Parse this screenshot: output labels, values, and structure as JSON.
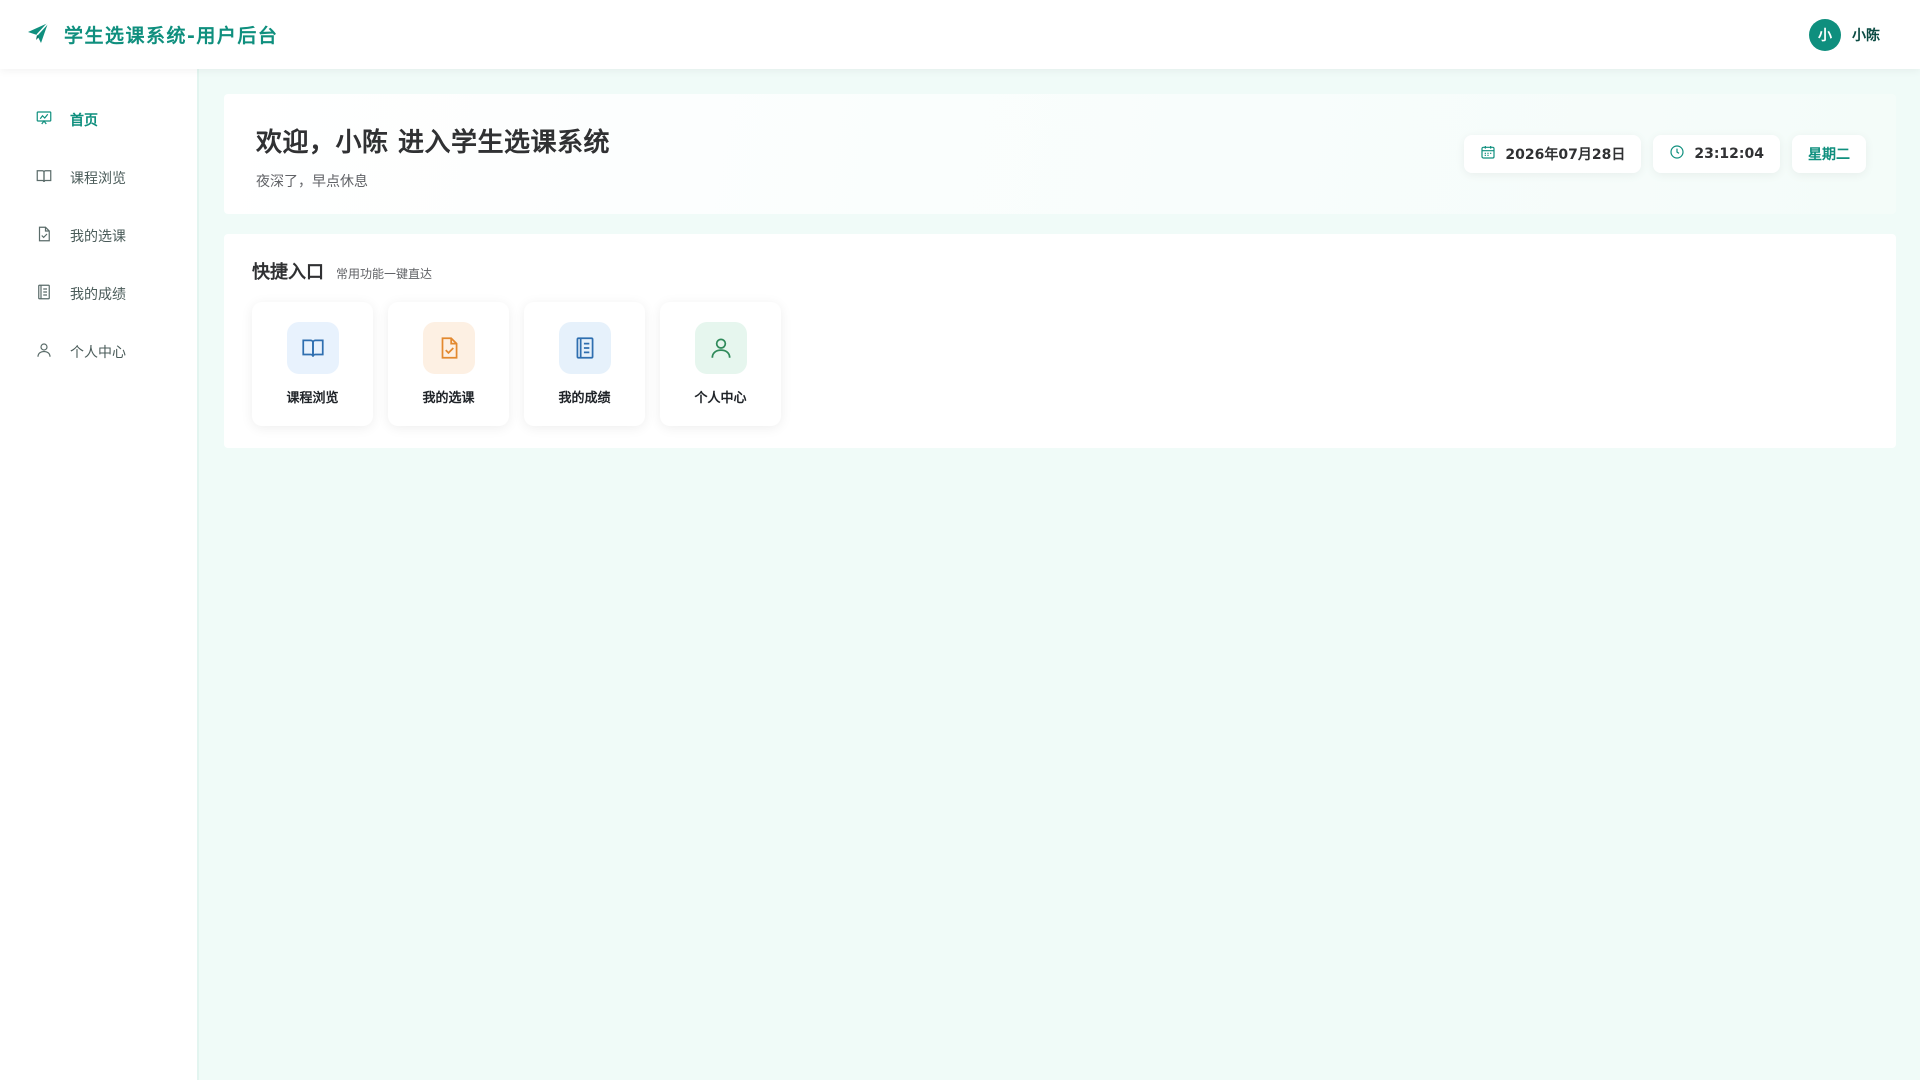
{
  "header": {
    "title": "学生选课系统-用户后台",
    "icon": "paper-plane-icon",
    "user": {
      "avatar_text": "小",
      "name": "小陈"
    }
  },
  "sidebar": {
    "items": [
      {
        "label": "首页",
        "icon": "dashboard-icon",
        "active": true
      },
      {
        "label": "课程浏览",
        "icon": "book-icon"
      },
      {
        "label": "我的选课",
        "icon": "document-check-icon"
      },
      {
        "label": "我的成绩",
        "icon": "notebook-icon"
      },
      {
        "label": "个人中心",
        "icon": "user-icon"
      }
    ]
  },
  "welcome": {
    "title": "欢迎，小陈 进入学生选课系统",
    "subtitle": "夜深了，早点休息",
    "date": "2026年07月28日",
    "time": "23:12:04",
    "weekday": "星期二"
  },
  "quick": {
    "title": "快捷入口",
    "subtitle": "常用功能一键直达",
    "cards": [
      {
        "label": "课程浏览",
        "icon": "book-icon",
        "bg": "#e8f2fd",
        "color": "#2f6fb0"
      },
      {
        "label": "我的选课",
        "icon": "document-check-icon",
        "bg": "#fdf0e3",
        "color": "#e3892f"
      },
      {
        "label": "我的成绩",
        "icon": "notebook-icon",
        "bg": "#e6f1fb",
        "color": "#2f6fb0"
      },
      {
        "label": "个人中心",
        "icon": "user-icon",
        "bg": "#e6f6ee",
        "color": "#2f8a5a"
      }
    ]
  },
  "colors": {
    "accent": "#0f8f7e",
    "background": "#f0fbf8"
  }
}
